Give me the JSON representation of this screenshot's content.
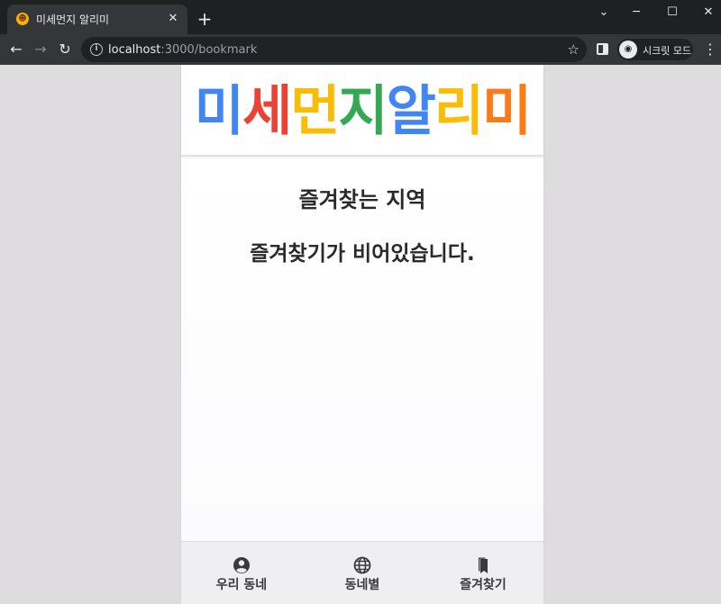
{
  "browser": {
    "tab_title": "미세먼지 알리미",
    "tab_favicon": "emoji-face-icon",
    "url_host": "localhost",
    "url_path": ":3000/bookmark",
    "profile_label": "시크릿 모드",
    "new_tab_symbol": "+",
    "close_symbol": "✕"
  },
  "header": {
    "logo_letters": [
      {
        "char": "미",
        "color": "#4285f4"
      },
      {
        "char": "세",
        "color": "#ea4335"
      },
      {
        "char": "먼",
        "color": "#fbbc05"
      },
      {
        "char": "지",
        "color": "#34a853"
      },
      {
        "char": "알",
        "color": "#4285f4"
      },
      {
        "char": "리",
        "color": "#fbbc05"
      },
      {
        "char": "미",
        "color": "#fa7b17"
      }
    ]
  },
  "main": {
    "title": "즐겨찾는 지역",
    "empty_message": "즐겨찾기가 비어있습니다."
  },
  "bottom_nav": {
    "items": [
      {
        "label": "우리 동네",
        "icon": "user-circle-icon"
      },
      {
        "label": "동네별",
        "icon": "globe-icon"
      },
      {
        "label": "즐겨찾기",
        "icon": "bookmark-icon"
      }
    ]
  }
}
